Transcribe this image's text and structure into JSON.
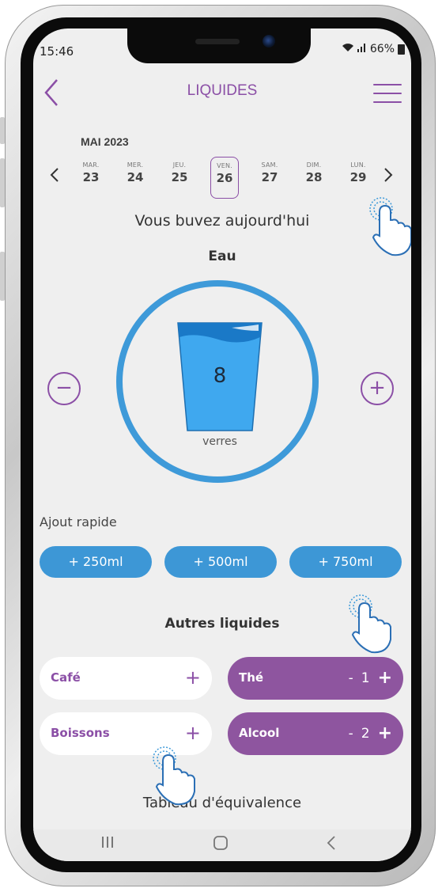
{
  "status_bar": {
    "time": "15:46",
    "battery": "66%"
  },
  "header": {
    "title": "LIQUIDES"
  },
  "calendar": {
    "month": "MAI 2023",
    "days": [
      {
        "name": "MAR.",
        "num": "23"
      },
      {
        "name": "MER.",
        "num": "24"
      },
      {
        "name": "JEU.",
        "num": "25"
      },
      {
        "name": "VEN.",
        "num": "26"
      },
      {
        "name": "SAM.",
        "num": "27"
      },
      {
        "name": "DIM.",
        "num": "28"
      },
      {
        "name": "LUN.",
        "num": "29"
      }
    ],
    "selected_day": "26"
  },
  "drink": {
    "headline": "Vous buvez aujourd'hui",
    "type": "Eau",
    "count": "8",
    "unit": "verres",
    "minus": "−",
    "plus": "+"
  },
  "quick_add": {
    "label": "Ajout rapide",
    "buttons": [
      "+  250ml",
      "+  500ml",
      "+  750ml"
    ]
  },
  "other_liquids": {
    "title": "Autres liquides",
    "items": [
      {
        "label": "Café",
        "action": "+"
      },
      {
        "label": "Thé",
        "decrement": "-",
        "value": "1",
        "increment": "+"
      },
      {
        "label": "Boissons",
        "action": "+"
      },
      {
        "label": "Alcool",
        "decrement": "-",
        "value": "2",
        "increment": "+"
      }
    ]
  },
  "equivalence": {
    "label": "Tableau d'équivalence"
  },
  "colors": {
    "accent": "#8b4fa6",
    "water": "#3d97d6",
    "background": "#efefef"
  }
}
